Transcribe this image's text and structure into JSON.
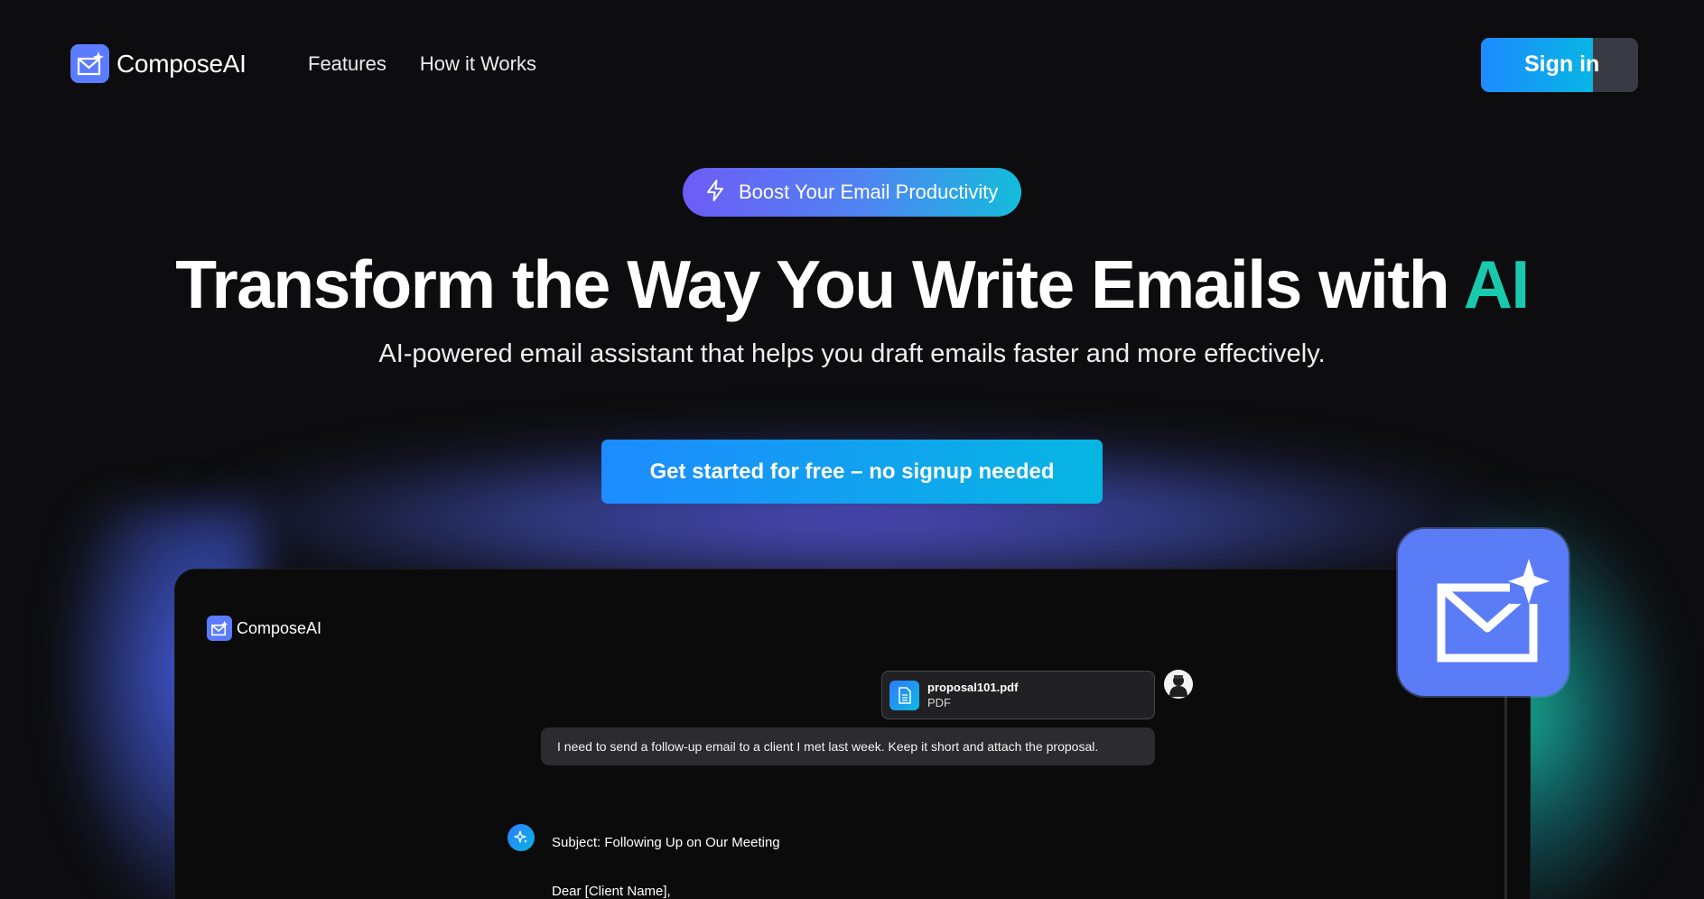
{
  "nav": {
    "brand": "ComposeAI",
    "links": [
      "Features",
      "How it Works"
    ],
    "signin_label": "Sign in"
  },
  "hero": {
    "badge": "Boost Your Email Productivity",
    "title_main": "Transform the Way You Write Emails with ",
    "title_accent": "AI",
    "subtitle": "AI-powered email assistant that helps you draft emails faster and more effectively.",
    "cta": "Get started for free – no signup needed"
  },
  "preview": {
    "brand": "ComposeAI",
    "attachment": {
      "name": "proposal101.pdf",
      "type": "PDF"
    },
    "user_message": "I need to send a follow-up email to a client I met last week. Keep it short and attach the proposal.",
    "reply_subject": "Subject: Following Up on Our Meeting",
    "reply_greeting": "Dear [Client Name],"
  },
  "colors": {
    "background": "#0d0d0f",
    "brand_blue": "#5b7cff",
    "accent_teal": "#19c9ad",
    "cta_gradient_start": "#1d8bff",
    "cta_gradient_end": "#06b6e2"
  },
  "icons": {
    "logo": "mail-sparkle-icon",
    "badge": "lightning-icon",
    "file": "document-icon",
    "ai": "sparkle-icon"
  }
}
